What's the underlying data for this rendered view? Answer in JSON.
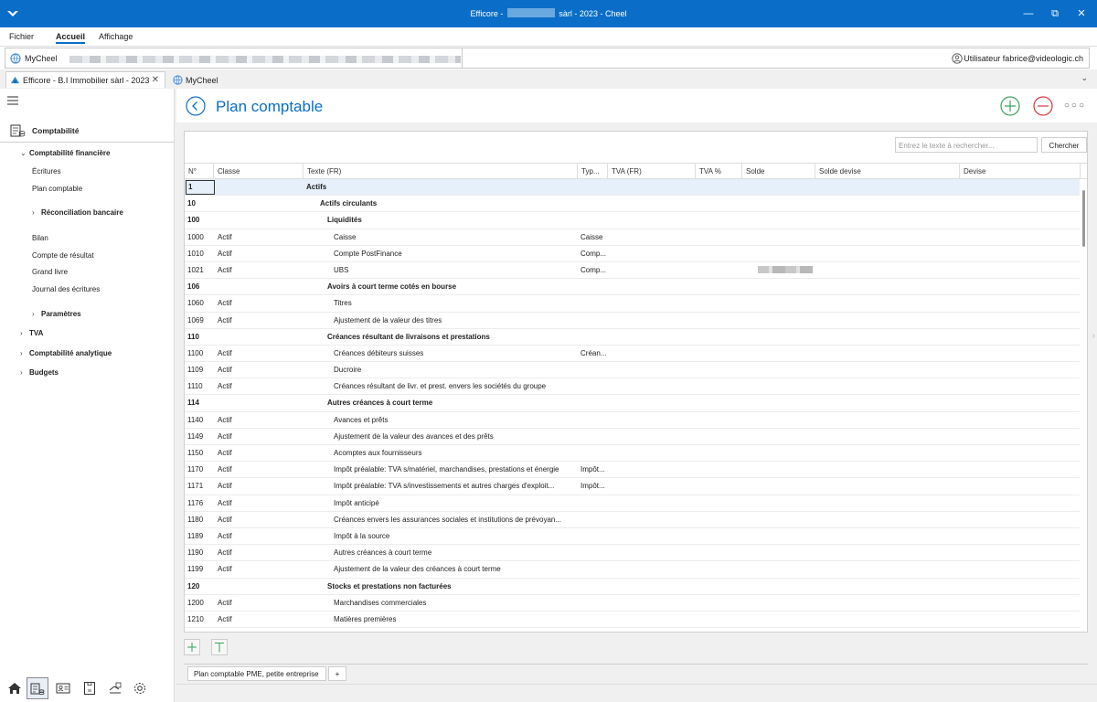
{
  "window": {
    "title_prefix": "Efficore -",
    "title_suffix": "sàrl - 2023 - Cheel",
    "controls": [
      "minimize-icon",
      "restore-icon",
      "close-icon"
    ]
  },
  "menu": {
    "items": [
      "Fichier",
      "Accueil",
      "Affichage"
    ],
    "active": "Accueil"
  },
  "addressbar": {
    "root": "MyCheel",
    "user": "Utilisateur fabrice@videologic.ch"
  },
  "doc_tabs": [
    {
      "label": "Efficore - B.I Immobilier sàrl - 2023",
      "closable": true,
      "active": true
    },
    {
      "label": "MyCheel",
      "closable": false,
      "active": false
    }
  ],
  "sidebar": {
    "section": "Comptabilité",
    "tree": [
      {
        "label": "Comptabilité financière",
        "bold": true,
        "chevron": "⌄"
      },
      {
        "label": "Écritures"
      },
      {
        "label": "Plan comptable"
      },
      {
        "label": "Réconciliation bancaire",
        "bold": true,
        "chevron": "›"
      },
      {
        "label": "Bilan"
      },
      {
        "label": "Compte de résultat"
      },
      {
        "label": "Grand livre"
      },
      {
        "label": "Journal des écritures"
      },
      {
        "label": "Paramètres",
        "bold": true,
        "chevron": "›"
      },
      {
        "label": "TVA",
        "bold": true,
        "chevron": "›"
      },
      {
        "label": "Comptabilité analytique",
        "bold": true,
        "chevron": "›"
      },
      {
        "label": "Budgets",
        "bold": true,
        "chevron": "›"
      }
    ],
    "bottom_icons": [
      "home-icon",
      "accounting-icon",
      "contacts-icon",
      "document-icon",
      "assets-icon",
      "settings-icon"
    ]
  },
  "page": {
    "title": "Plan comptable",
    "search_placeholder": "Entrez le texte à rechercher...",
    "search_button": "Chercher",
    "more": "○○○",
    "sheet_tab": "Plan comptable PME, petite entreprise",
    "add_sheet": "+"
  },
  "table": {
    "columns": [
      "N°",
      "Classe",
      "Texte (FR)",
      "Typ...",
      "TVA (FR)",
      "TVA %",
      "Solde",
      "Solde devise",
      "Devise"
    ],
    "rows": [
      {
        "no": "1",
        "classe": "",
        "texte": "Actifs",
        "type": "",
        "level": 0,
        "group": true,
        "selected": true
      },
      {
        "no": "10",
        "classe": "",
        "texte": "Actifs circulants",
        "type": "",
        "level": 1,
        "group": true
      },
      {
        "no": "100",
        "classe": "",
        "texte": "Liquidités",
        "type": "",
        "level": 2,
        "group": true
      },
      {
        "no": "1000",
        "classe": "Actif",
        "texte": "Caisse",
        "type": "Caisse",
        "level": 3
      },
      {
        "no": "1010",
        "classe": "Actif",
        "texte": "Compte PostFinance",
        "type": "Comp...",
        "level": 3
      },
      {
        "no": "1021",
        "classe": "Actif",
        "texte": "UBS",
        "type": "Comp...",
        "level": 3,
        "balance_hidden": true
      },
      {
        "no": "106",
        "classe": "",
        "texte": "Avoirs à court terme cotés en bourse",
        "type": "",
        "level": 2,
        "group": true
      },
      {
        "no": "1060",
        "classe": "Actif",
        "texte": "Titres",
        "type": "",
        "level": 3
      },
      {
        "no": "1069",
        "classe": "Actif",
        "texte": "Ajustement de la valeur des titres",
        "type": "",
        "level": 3
      },
      {
        "no": "110",
        "classe": "",
        "texte": "Créances résultant de livraisons et prestations",
        "type": "",
        "level": 2,
        "group": true
      },
      {
        "no": "1100",
        "classe": "Actif",
        "texte": "Créances débiteurs suisses",
        "type": "Créan...",
        "level": 3
      },
      {
        "no": "1109",
        "classe": "Actif",
        "texte": "Ducroire",
        "type": "",
        "level": 3
      },
      {
        "no": "1110",
        "classe": "Actif",
        "texte": "Créances résultant de livr. et prest. envers les sociétés du groupe",
        "type": "",
        "level": 3
      },
      {
        "no": "114",
        "classe": "",
        "texte": "Autres créances à court terme",
        "type": "",
        "level": 2,
        "group": true
      },
      {
        "no": "1140",
        "classe": "Actif",
        "texte": "Avances et prêts",
        "type": "",
        "level": 3
      },
      {
        "no": "1149",
        "classe": "Actif",
        "texte": "Ajustement de la valeur des avances et des prêts",
        "type": "",
        "level": 3
      },
      {
        "no": "1150",
        "classe": "Actif",
        "texte": "Acomptes aux fournisseurs",
        "type": "",
        "level": 3
      },
      {
        "no": "1170",
        "classe": "Actif",
        "texte": "Impôt préalable: TVA s/matériel, marchandises, prestations et énergie",
        "type": "Impôt...",
        "level": 3
      },
      {
        "no": "1171",
        "classe": "Actif",
        "texte": "Impôt préalable: TVA s/investissements et autres charges d'exploit...",
        "type": "Impôt...",
        "level": 3
      },
      {
        "no": "1176",
        "classe": "Actif",
        "texte": "Impôt anticipé",
        "type": "",
        "level": 3
      },
      {
        "no": "1180",
        "classe": "Actif",
        "texte": "Créances envers les assurances sociales et institutions de prévoyan...",
        "type": "",
        "level": 3
      },
      {
        "no": "1189",
        "classe": "Actif",
        "texte": "Impôt à la source",
        "type": "",
        "level": 3
      },
      {
        "no": "1190",
        "classe": "Actif",
        "texte": "Autres créances à court terme",
        "type": "",
        "level": 3
      },
      {
        "no": "1199",
        "classe": "Actif",
        "texte": "Ajustement de la valeur des créances à court terme",
        "type": "",
        "level": 3
      },
      {
        "no": "120",
        "classe": "",
        "texte": "Stocks et prestations non facturées",
        "type": "",
        "level": 2,
        "group": true
      },
      {
        "no": "1200",
        "classe": "Actif",
        "texte": "Marchandises commerciales",
        "type": "",
        "level": 3
      },
      {
        "no": "1210",
        "classe": "Actif",
        "texte": "Matières premières",
        "type": "",
        "level": 3
      }
    ]
  },
  "colors": {
    "accent": "#0a6ec8",
    "add": "#3aa35b",
    "remove": "#d9363e",
    "selection": "#e6f0fa"
  }
}
